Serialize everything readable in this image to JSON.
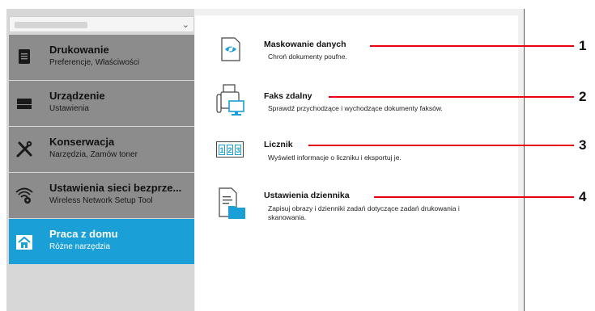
{
  "sidebar": {
    "items": [
      {
        "title": "Drukowanie",
        "subtitle": "Preferencje, Właściwości",
        "icon": "printer-doc-icon"
      },
      {
        "title": "Urządzenie",
        "subtitle": "Ustawienia",
        "icon": "device-icon"
      },
      {
        "title": "Konserwacja",
        "subtitle": "Narzędzia, Zamów toner",
        "icon": "tools-icon"
      },
      {
        "title": "Ustawienia sieci bezprze...",
        "subtitle": "Wireless Network Setup Tool",
        "icon": "wifi-gear-icon"
      },
      {
        "title": "Praca z domu",
        "subtitle": "Różne narzędzia",
        "icon": "home-icon",
        "active": true
      }
    ]
  },
  "features": [
    {
      "title": "Maskowanie danych",
      "description": "Chroń dokumenty poufne.",
      "icon": "eye-mask-icon",
      "callout": "1"
    },
    {
      "title": "Faks zdalny",
      "description": "Sprawdź przychodzące i wychodzące dokumenty faksów.",
      "icon": "remote-fax-icon",
      "callout": "2"
    },
    {
      "title": "Licznik",
      "description": "Wyświetl informacje o liczniku i eksportuj je.",
      "icon": "counter-icon",
      "callout": "3",
      "counter_digits": "123"
    },
    {
      "title": "Ustawienia dziennika",
      "description": "Zapisuj obrazy i dzienniki zadań dotyczące zadań drukowania i skanowania.",
      "icon": "log-folder-icon",
      "callout": "4"
    }
  ],
  "colors": {
    "active": "#1a9fd6",
    "callout": "#e8000f",
    "nav": "#8c8c8c"
  }
}
